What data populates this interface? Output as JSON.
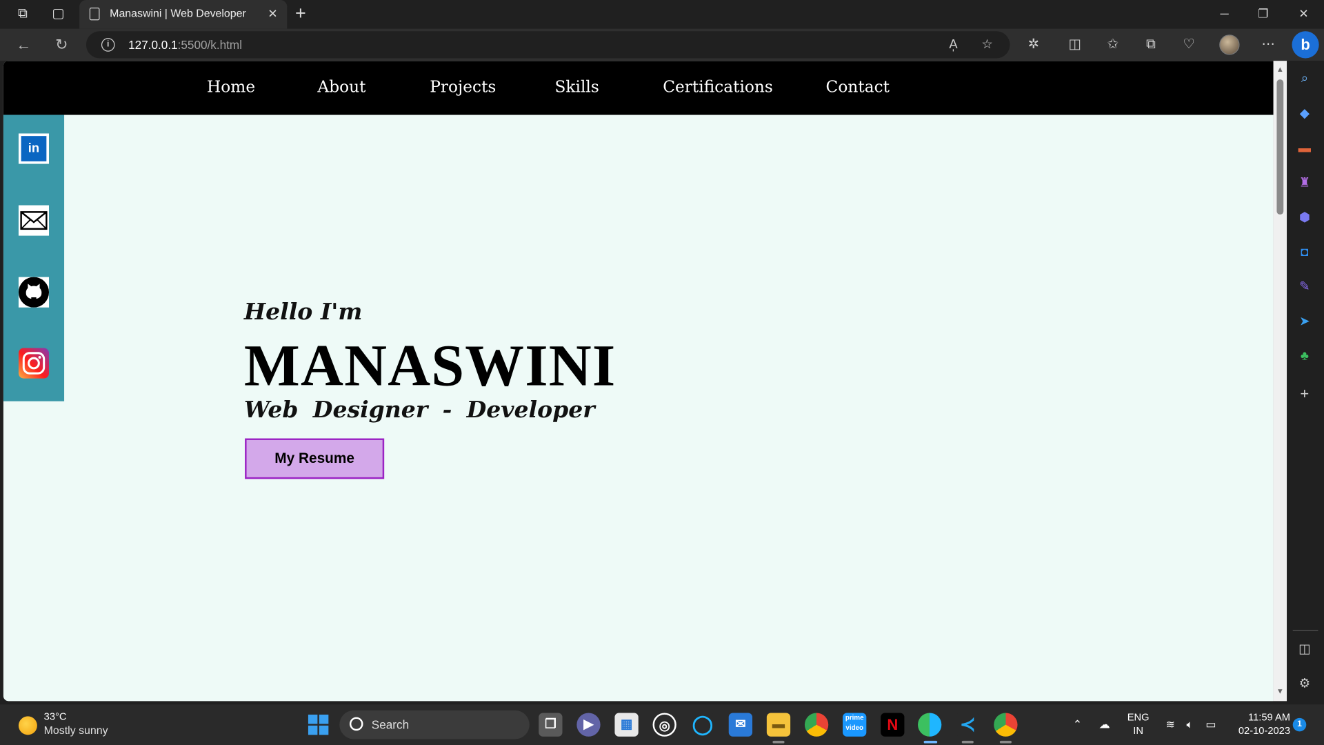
{
  "browser": {
    "tab_title": "Manaswini | Web Developer",
    "url_host": "127.0.0.1",
    "url_rest": ":5500/k.html",
    "read_aloud_label": "A̩",
    "profile_icon": "profile-avatar"
  },
  "site": {
    "nav": [
      "Home",
      "About",
      "Projects",
      "Skills",
      "Certifications",
      "Contact"
    ],
    "greeting": "Hello I'm",
    "name": "MANASWINI",
    "role": "Web  Designer  -  Developer",
    "resume_button": "My Resume",
    "linkedin_label": "in",
    "background_color": "#eefaf7",
    "social_bar_color": "#3a98a8",
    "button_color": "#d3a8ea"
  },
  "taskbar": {
    "temperature": "33°C",
    "condition": "Mostly sunny",
    "search_placeholder": "Search",
    "language": "ENG",
    "region": "IN",
    "time": "11:59 AM",
    "date": "02-10-2023",
    "notification_count": "1"
  }
}
